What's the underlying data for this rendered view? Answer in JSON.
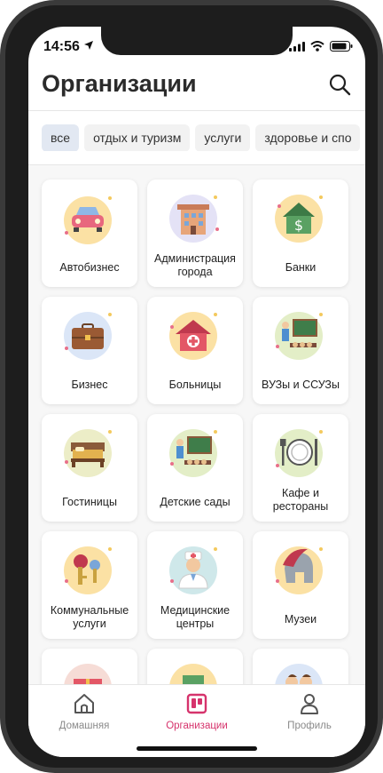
{
  "status_bar": {
    "time": "14:56"
  },
  "header": {
    "title": "Организации"
  },
  "chips": [
    {
      "label": "все",
      "active": true
    },
    {
      "label": "отдых и туризм",
      "active": false
    },
    {
      "label": "услуги",
      "active": false
    },
    {
      "label": "здоровье и спо",
      "active": false
    }
  ],
  "categories": [
    {
      "label": "Автобизнес",
      "icon": "car-icon"
    },
    {
      "label": "Администрация города",
      "icon": "city-administration-icon"
    },
    {
      "label": "Банки",
      "icon": "bank-icon"
    },
    {
      "label": "Бизнес",
      "icon": "briefcase-icon"
    },
    {
      "label": "Больницы",
      "icon": "hospital-icon"
    },
    {
      "label": "ВУЗы и ССУЗы",
      "icon": "university-icon"
    },
    {
      "label": "Гостиницы",
      "icon": "hotel-bed-icon"
    },
    {
      "label": "Детские сады",
      "icon": "kindergarten-icon"
    },
    {
      "label": "Кафе и рестораны",
      "icon": "restaurant-plate-icon"
    },
    {
      "label": "Коммунальные услуги",
      "icon": "keys-icon"
    },
    {
      "label": "Медицинские центры",
      "icon": "doctor-icon"
    },
    {
      "label": "Музеи",
      "icon": "helmet-icon"
    },
    {
      "label": "",
      "icon": "gift-icon"
    },
    {
      "label": "",
      "icon": "building-icon"
    },
    {
      "label": "",
      "icon": "people-icon"
    }
  ],
  "tab_bar": {
    "home": "Домашняя",
    "organizations": "Организации",
    "profile": "Профиль"
  },
  "colors": {
    "accent": "#d6336c",
    "chip_active": "#e2e8f2"
  }
}
